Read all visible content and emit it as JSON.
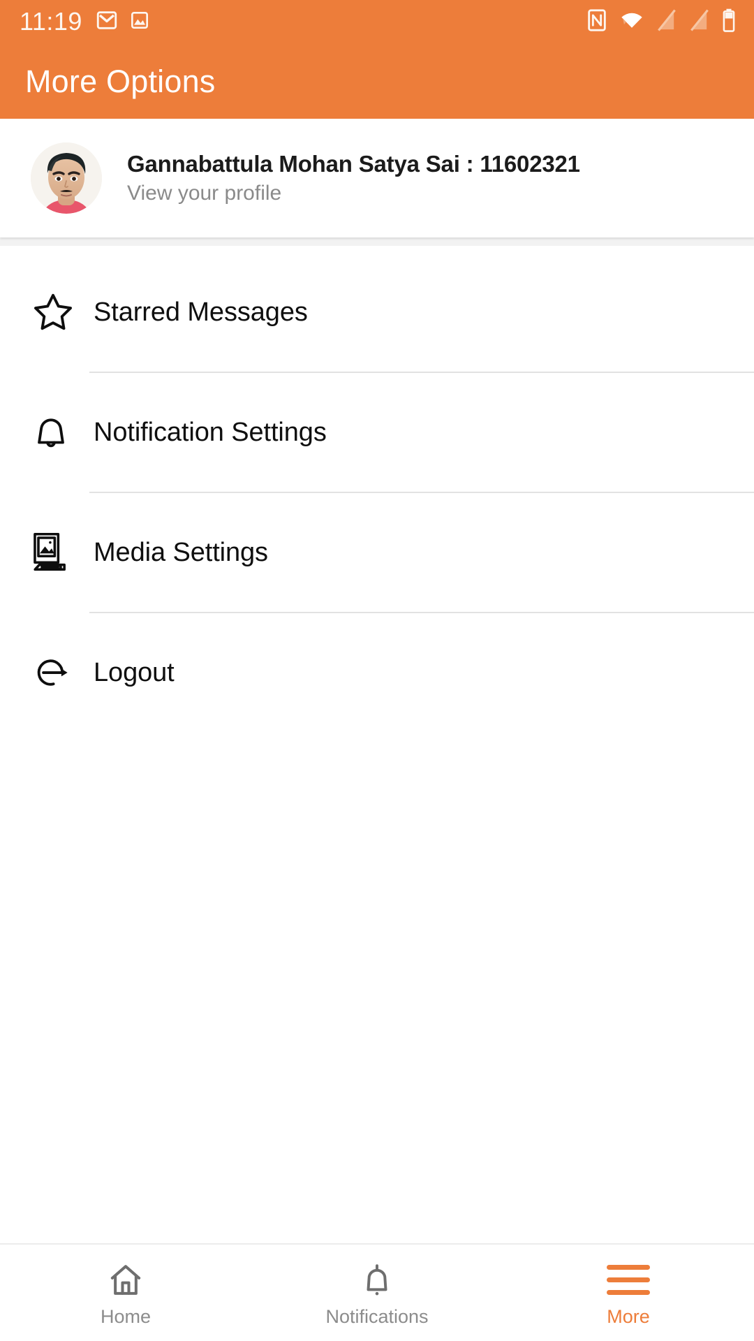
{
  "status_bar": {
    "clock": "11:19",
    "left_icons": [
      "gmail-icon",
      "image-icon"
    ],
    "right_icons": [
      "nfc-icon",
      "wifi-icon",
      "signal-off-icon",
      "signal-off-icon",
      "battery-icon"
    ]
  },
  "app_bar": {
    "title": "More Options",
    "background_color": "#ED7D3A",
    "title_color": "#FFFFFF"
  },
  "profile": {
    "name": "Gannabattula Mohan Satya Sai : 11602321",
    "subtitle": "View your profile",
    "avatar_icon": "user-photo-avatar"
  },
  "menu": {
    "items": [
      {
        "label": "Starred Messages",
        "icon": "star-icon"
      },
      {
        "label": "Notification Settings",
        "icon": "bell-icon"
      },
      {
        "label": "Media Settings",
        "icon": "media-image-pencil-icon"
      },
      {
        "label": "Logout",
        "icon": "logout-arrow-icon"
      }
    ]
  },
  "bottom_nav": {
    "items": [
      {
        "label": "Home",
        "icon": "home-icon",
        "active": false
      },
      {
        "label": "Notifications",
        "icon": "bell-icon",
        "active": false
      },
      {
        "label": "More",
        "icon": "hamburger-menu-icon",
        "active": true
      }
    ],
    "active_color": "#ED7D3A",
    "inactive_color": "#8C8C8C"
  }
}
